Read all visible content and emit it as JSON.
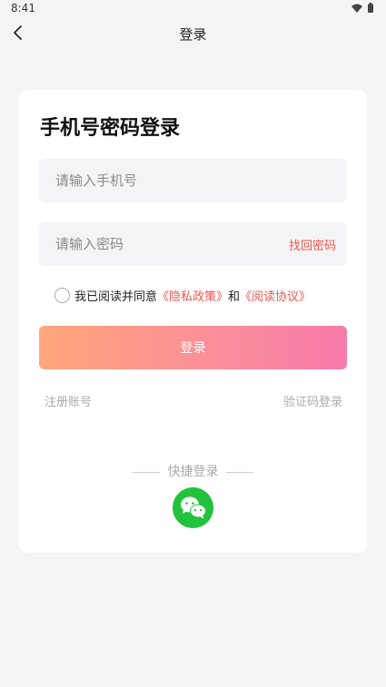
{
  "status_bar": {
    "time": "8:41"
  },
  "nav": {
    "title": "登录"
  },
  "card": {
    "title": "手机号密码登录",
    "phone_placeholder": "请输入手机号",
    "password_placeholder": "请输入密码",
    "forgot_password": "找回密码",
    "agreement": {
      "prefix": "我已阅读并同意",
      "privacy_policy": "《隐私政策》",
      "conjunction": "和",
      "user_agreement": "《阅读协议》"
    },
    "login_button": "登录",
    "register": "注册账号",
    "sms_login": "验证码登录",
    "quick_login": "快捷登录"
  },
  "colors": {
    "accent_red": "#f0564e",
    "gradient_start": "#ffa67a",
    "gradient_end": "#f77aab",
    "wechat_green": "#22c23c"
  },
  "icons": {
    "back": "chevron-left-icon",
    "wifi": "wifi-icon",
    "battery": "battery-icon",
    "wechat": "wechat-icon"
  }
}
